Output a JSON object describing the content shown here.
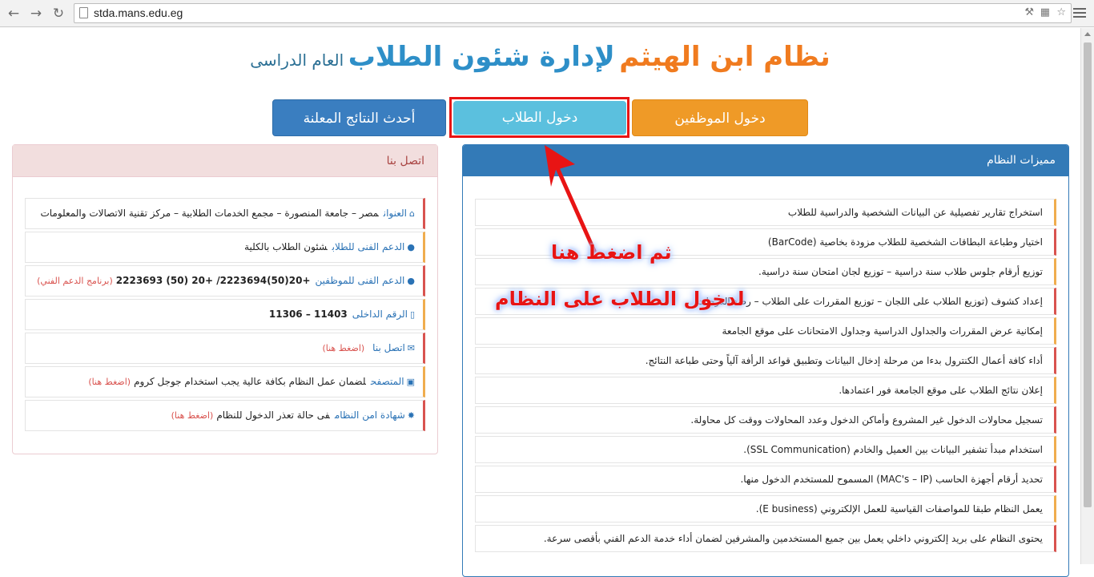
{
  "browser": {
    "url": "stda.mans.edu.eg"
  },
  "header": {
    "title_part1": "نظام ابن الهيثم",
    "title_part2": "لإدارة شئون الطلاب",
    "title_part3": "العام الدراسى"
  },
  "buttons": {
    "employees": "دخول الموظفين",
    "students": "دخول الطلاب",
    "results": "أحدث النتائج المعلنة"
  },
  "features": {
    "title": "مميزات النظام",
    "items": [
      "استخراج تقارير تفصيلية عن البيانات الشخصية والدراسية للطلاب",
      "اختيار وطباعة البطاقات الشخصية للطلاب مزودة بخاصية (BarCode)",
      "توزيع أرقام جلوس طلاب سنة دراسية – توزيع لجان امتحان سنة دراسية.",
      "إعداد كشوف (توزيع الطلاب على اللجان – توزيع المقررات على الطلاب – رصد الدرجات",
      "إمكانية عرض المقررات والجداول الدراسية وجداول الامتحانات على موقع الجامعة",
      "أداء كافة أعمال الكنترول بدءا من مرحلة إدخال البيانات وتطبيق قواعد الرأفة آلياً وحتى طباعة النتائج.",
      "إعلان نتائج الطلاب على موقع الجامعة فور اعتمادها.",
      "تسجيل محاولات الدخول غير المشروع وأماكن الدخول وعدد المحاولات ووقت كل محاولة.",
      "استخدام مبدأ تشفير البيانات بين العميل والخادم (SSL Communication).",
      "تحديد أرقام أجهزة الحاسب (MAC's – IP) المسموح للمستخدم الدخول منها.",
      "يعمل النظام طبقا للمواصفات القياسية للعمل الإلكتروني (E business).",
      "يحتوى النظام على بريد إلكتروني داخلي يعمل بين جميع المستخدمين والمشرفين لضمان أداء خدمة الدعم الفني بأقصى سرعة."
    ]
  },
  "contact": {
    "title": "اتصل بنا",
    "items": [
      {
        "icon": "home-icon",
        "glyph": "⌂",
        "label": "العنوان",
        "value": "مصر – جامعة المنصورة – مجمع الخدمات الطلابية – مركز تقنية الاتصالات والمعلومات",
        "note": ""
      },
      {
        "icon": "user-icon",
        "glyph": "●",
        "label": "الدعم الفنى للطلاب",
        "value": "شئون الطلاب بالكلية",
        "note": ""
      },
      {
        "icon": "user-icon",
        "glyph": "●",
        "label": "الدعم الفنى للموظفين",
        "value": "+20(50)2223694/ +20 (50) 2223693",
        "note": "(برنامج الدعم الفني)"
      },
      {
        "icon": "phone-icon",
        "glyph": "▯",
        "label": "الرقم الداخلى",
        "value": "11403 – 11306",
        "note": ""
      },
      {
        "icon": "envelope-icon",
        "glyph": "✉",
        "label": "اتصل بنا",
        "value": "",
        "note": "(اضغط هنا)"
      },
      {
        "icon": "browser-icon",
        "glyph": "▣",
        "label": "المتصفح",
        "value": "لضمان عمل النظام بكافة عالية يجب استخدام جوجل كروم",
        "note": "(اضغط هنا)"
      },
      {
        "icon": "certificate-icon",
        "glyph": "✸",
        "label": "شهادة امن النظام",
        "value": "فى حالة تعذر الدخول للنظام",
        "note": "(اضغط هنا)"
      }
    ]
  },
  "annotation": {
    "line1": "ثم اضغط هنا",
    "line2": "لدخول الطلاب على النظام"
  },
  "colors": {
    "accent_red": "#e81414",
    "primary_blue": "#337ab7",
    "orange": "#ef9a27",
    "light_blue": "#5bc0de"
  }
}
